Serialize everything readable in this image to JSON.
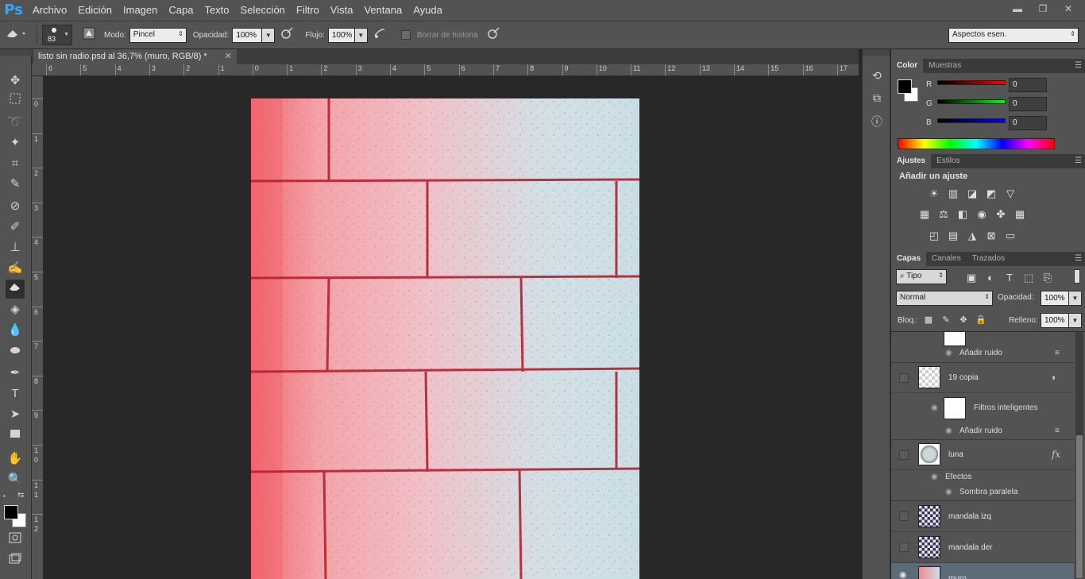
{
  "app": {
    "logo": "Ps",
    "colors": {
      "accent": "#31a8ff",
      "panel": "#535353",
      "canvas_bg": "#282828"
    }
  },
  "menu": [
    "Archivo",
    "Edición",
    "Imagen",
    "Capa",
    "Texto",
    "Selección",
    "Filtro",
    "Vista",
    "Ventana",
    "Ayuda"
  ],
  "window_controls": {
    "minimize": "▬",
    "restore": "❐",
    "close": "✕"
  },
  "options_bar": {
    "brush_size": "83",
    "modo_label": "Modo:",
    "modo_value": "Pincel",
    "opacidad_label": "Opacidad:",
    "opacidad_value": "100%",
    "flujo_label": "Flujo:",
    "flujo_value": "100%",
    "borrar_historia_label": "Borrar de historia",
    "workspace": "Aspectos esen."
  },
  "document": {
    "tab_title": "listo sin radio.psd al 36,7% (muro, RGB/8) *",
    "close": "✕"
  },
  "ruler_h": [
    "6",
    "5",
    "4",
    "3",
    "2",
    "1",
    "0",
    "1",
    "2",
    "3",
    "4",
    "5",
    "6",
    "7",
    "8",
    "9",
    "10",
    "11",
    "12",
    "13",
    "14",
    "15",
    "16",
    "17"
  ],
  "ruler_v": [
    "0",
    "1",
    "2",
    "3",
    "4",
    "5",
    "6",
    "7",
    "8",
    "9",
    "1\n0",
    "1\n1",
    "1\n2"
  ],
  "color_panel": {
    "tabs": [
      "Color",
      "Muestras"
    ],
    "r_label": "R",
    "r_value": "0",
    "g_label": "G",
    "g_value": "0",
    "b_label": "B",
    "b_value": "0"
  },
  "adjust_panel": {
    "tabs": [
      "Ajustes",
      "Estilos"
    ],
    "title": "Añadir un ajuste"
  },
  "layers_panel": {
    "tabs": [
      "Capas",
      "Canales",
      "Trazados"
    ],
    "filter_kind": "Tipo",
    "blend_mode": "Normal",
    "opacity_label": "Opacidad:",
    "opacity_value": "100%",
    "lock_label": "Bloq.:",
    "fill_label": "Relleno:",
    "fill_value": "100%",
    "top_partial": {
      "sub_filter": "Añadir ruido"
    },
    "layers": [
      {
        "name": "19 copia",
        "smart_filters": "Filtros inteligentes",
        "filter": "Añadir ruido"
      },
      {
        "name": "luna",
        "fx": "fx",
        "effects": "Efectos",
        "effect": "Sombra paralela"
      },
      {
        "name": "mandala izq"
      },
      {
        "name": "mandala der"
      },
      {
        "name": "muro"
      }
    ]
  }
}
